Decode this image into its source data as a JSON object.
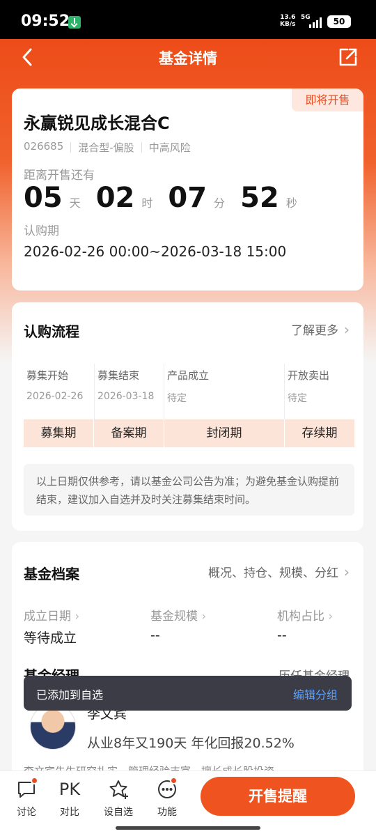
{
  "status_bar": {
    "time": "09:52",
    "net_speed_value": "13.6",
    "net_speed_unit": "KB/s",
    "network": "5G",
    "battery": "50"
  },
  "header": {
    "title": "基金详情"
  },
  "fund": {
    "status_badge": "即将开售",
    "name": "永赢锐见成长混合C",
    "code": "026685",
    "type": "混合型-偏股",
    "risk": "中高风险",
    "countdown_label": "距离开售还有",
    "countdown": {
      "days": "05",
      "days_unit": "天",
      "hours": "02",
      "hours_unit": "时",
      "minutes": "07",
      "minutes_unit": "分",
      "seconds": "52",
      "seconds_unit": "秒"
    },
    "subscription_label": "认购期",
    "subscription_period": "2026-02-26 00:00~2026-03-18 15:00"
  },
  "process": {
    "title": "认购流程",
    "more": "了解更多",
    "steps": [
      {
        "title": "募集开始",
        "date": "2026-02-26"
      },
      {
        "title": "募集结束",
        "date": "2026-03-18"
      },
      {
        "title": "产品成立",
        "date": "待定"
      },
      {
        "title": "开放卖出",
        "date": "待定"
      }
    ],
    "phases": [
      "募集期",
      "备案期",
      "封闭期",
      "存续期"
    ],
    "notice": "以上日期仅供参考，请以基金公司公告为准；为避免基金认购提前结束，建议加入自选并及时关注募集结束时间。"
  },
  "profile": {
    "title": "基金档案",
    "more": "概况、持仓、规模、分红",
    "stats": [
      {
        "label": "成立日期",
        "value": "等待成立"
      },
      {
        "label": "基金规模",
        "value": "--"
      },
      {
        "label": "机构占比",
        "value": "--"
      }
    ],
    "manager_title": "基金经理",
    "manager_history": "历任基金经理",
    "manager_name": "李文宾",
    "manager_desc": "从业8年又190天 年化回报20.52%",
    "manager_more": "李文宾先生研究扎实，管理经验丰富，擅长成长股投资"
  },
  "toast": {
    "text": "已添加到自选",
    "action": "编辑分组"
  },
  "bottom_bar": {
    "items": [
      {
        "label": "讨论",
        "icon": "chat-icon"
      },
      {
        "label": "对比",
        "icon": "pk-icon",
        "icon_text": "PK"
      },
      {
        "label": "设自选",
        "icon": "star-add-icon"
      },
      {
        "label": "功能",
        "icon": "more-icon"
      }
    ],
    "cta": "开售提醒"
  },
  "colors": {
    "brand": "#ec4a1c",
    "link": "#5aa0ff",
    "phase_bg": "#fde4d8"
  }
}
